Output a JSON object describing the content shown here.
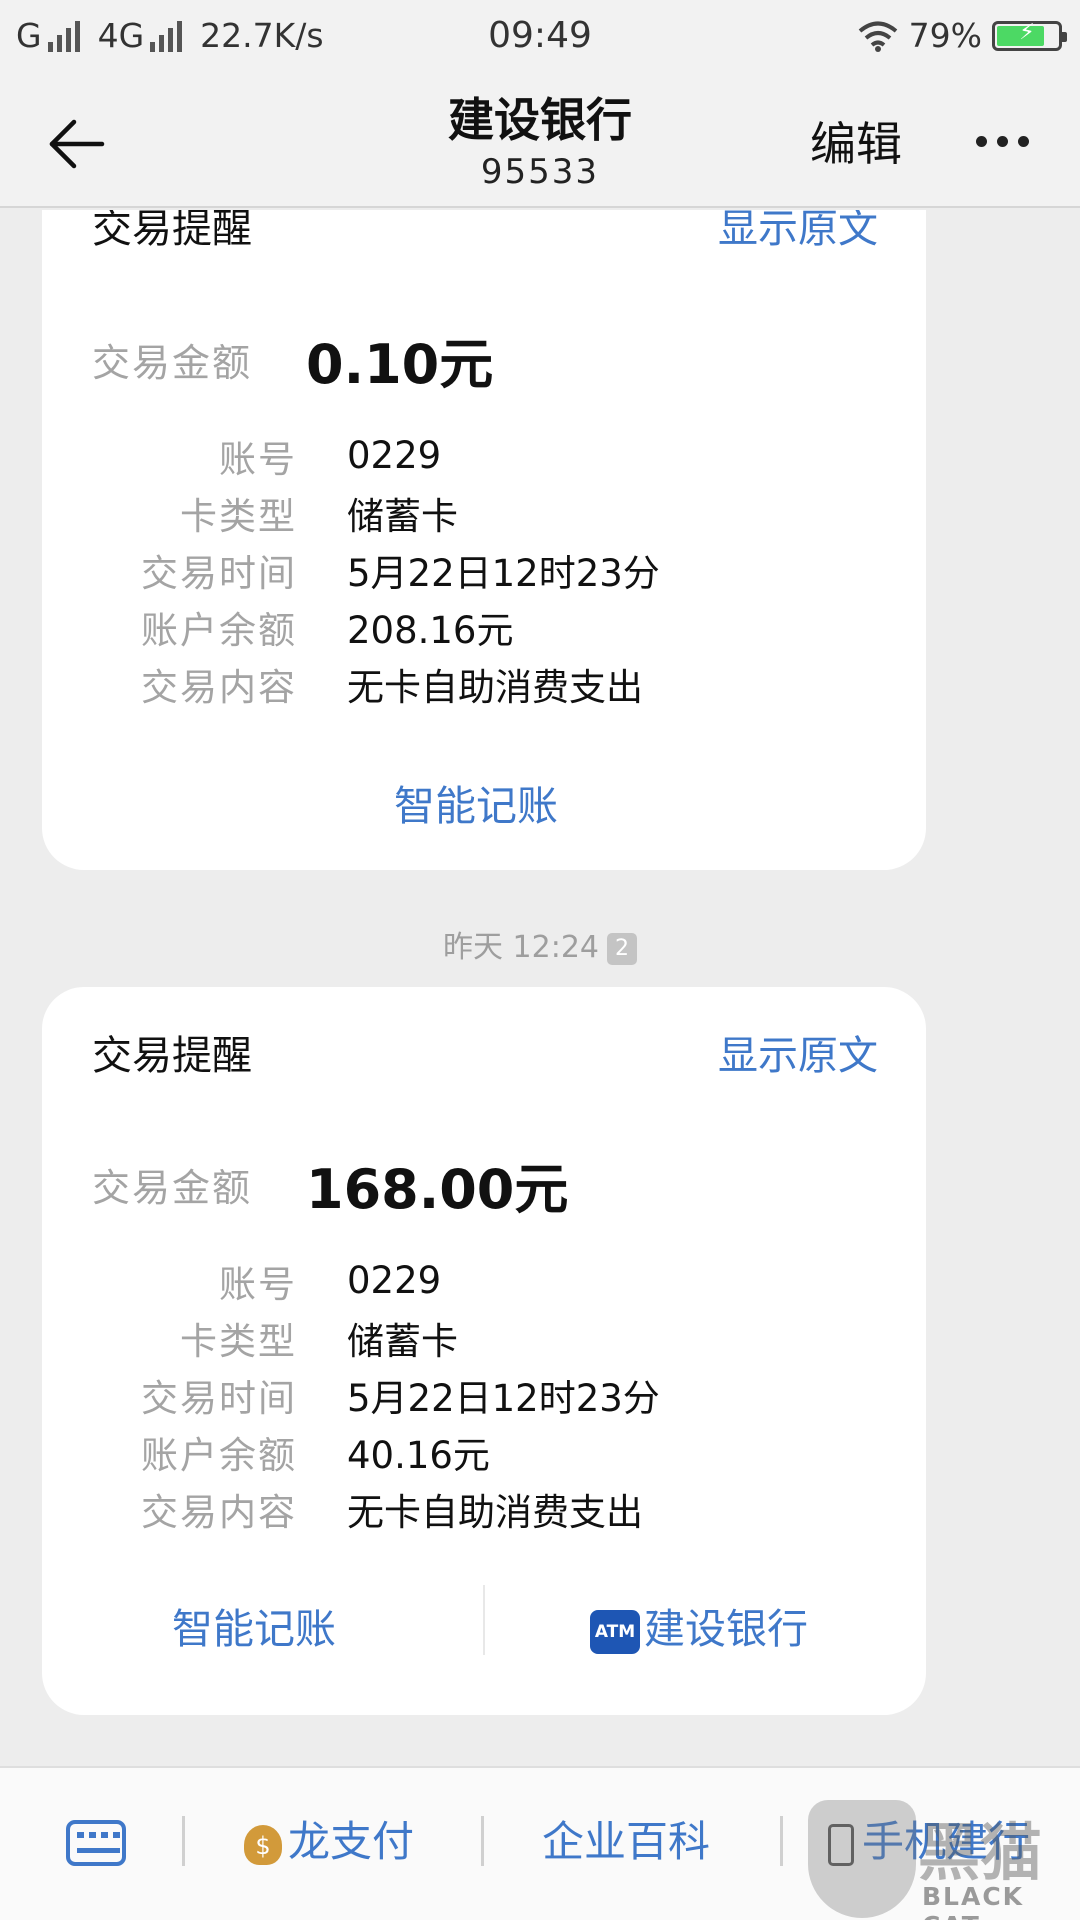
{
  "status_bar": {
    "carrier": "G",
    "network": "4G",
    "speed": "22.7K/s",
    "time": "09:49",
    "battery_percent": "79%",
    "battery_level": 0.79
  },
  "nav": {
    "title": "建设银行",
    "subtitle": "95533",
    "edit_label": "编辑"
  },
  "cards": [
    {
      "title": "交易提醒",
      "show_original": "显示原文",
      "amount_label": "交易金额",
      "amount_value": "0.10元",
      "rows": [
        {
          "label": "账号",
          "value": "0229"
        },
        {
          "label": "卡类型",
          "value": "储蓄卡"
        },
        {
          "label": "交易时间",
          "value": "5月22日12时23分"
        },
        {
          "label": "账户余额",
          "value": "208.16元"
        },
        {
          "label": "交易内容",
          "value": "无卡自助消费支出"
        }
      ],
      "action_left": "智能记账"
    },
    {
      "title": "交易提醒",
      "show_original": "显示原文",
      "amount_label": "交易金额",
      "amount_value": "168.00元",
      "rows": [
        {
          "label": "账号",
          "value": "0229"
        },
        {
          "label": "卡类型",
          "value": "储蓄卡"
        },
        {
          "label": "交易时间",
          "value": "5月22日12时23分"
        },
        {
          "label": "账户余额",
          "value": "40.16元"
        },
        {
          "label": "交易内容",
          "value": "无卡自助消费支出"
        }
      ],
      "action_left": "智能记账",
      "action_right_icon_text": "ATM",
      "action_right": "建设银行"
    }
  ],
  "time_separator": {
    "text": "昨天 12:24",
    "badge": "2"
  },
  "bottom_bar": {
    "item_1": "龙支付",
    "item_2": "企业百科",
    "item_3": "手机建行"
  },
  "watermark": {
    "cn": "黑猫",
    "en": "BLACK CAT"
  },
  "colors": {
    "accent": "#3f78c9",
    "label_gray": "#a4a4a4",
    "background": "#ededed"
  }
}
